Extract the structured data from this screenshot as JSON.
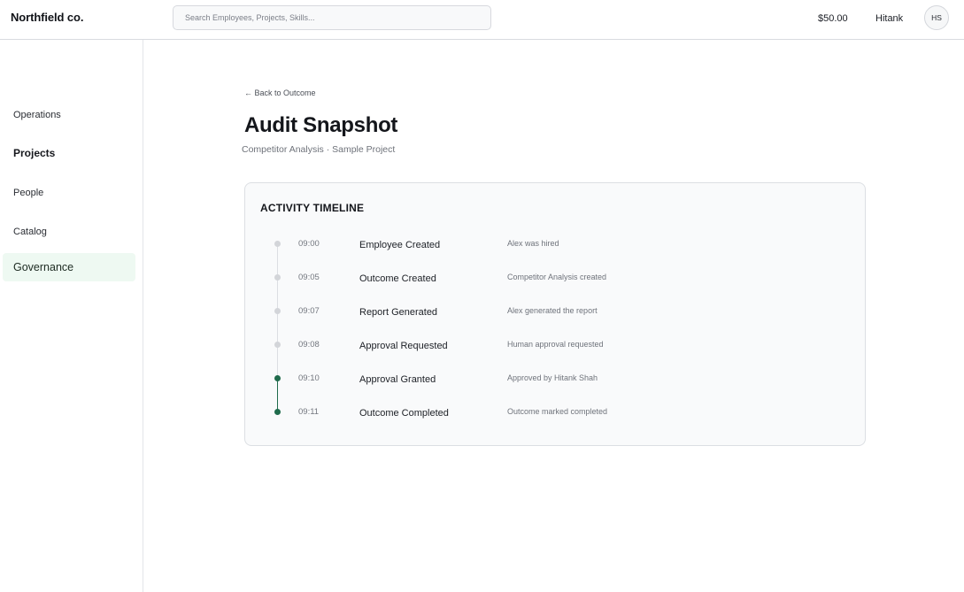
{
  "header": {
    "brand": "Northfield co.",
    "search_placeholder": "Search Employees, Projects, Skills...",
    "balance": "$50.00",
    "username": "Hitank",
    "avatar_initials": "HS"
  },
  "sidebar": {
    "items": [
      {
        "label": "Operations",
        "state": "normal"
      },
      {
        "label": "Projects",
        "state": "bold"
      },
      {
        "label": "People",
        "state": "normal"
      },
      {
        "label": "Catalog",
        "state": "normal"
      },
      {
        "label": "Governance",
        "state": "active"
      }
    ]
  },
  "main": {
    "back_link": "← Back to Outcome",
    "title": "Audit Snapshot",
    "subtitle": "Competitor Analysis · Sample Project"
  },
  "timeline": {
    "heading": "ACTIVITY TIMELINE",
    "entries": [
      {
        "time": "09:00",
        "event": "Employee Created",
        "detail": "Alex was hired",
        "status": "pending"
      },
      {
        "time": "09:05",
        "event": "Outcome Created",
        "detail": "Competitor Analysis created",
        "status": "pending"
      },
      {
        "time": "09:07",
        "event": "Report Generated",
        "detail": "Alex generated the report",
        "status": "pending"
      },
      {
        "time": "09:08",
        "event": "Approval Requested",
        "detail": "Human approval requested",
        "status": "pending"
      },
      {
        "time": "09:10",
        "event": "Approval Granted",
        "detail": "Approved by Hitank Shah",
        "status": "complete"
      },
      {
        "time": "09:11",
        "event": "Outcome Completed",
        "detail": "Outcome marked completed",
        "status": "complete"
      }
    ]
  },
  "colors": {
    "dot_pending": "#d3d5d9",
    "dot_complete": "#1f6b4c",
    "line_pending": "#dcdee2",
    "line_complete": "#1f6b4c",
    "nav_active_bg": "#eef9f2"
  }
}
